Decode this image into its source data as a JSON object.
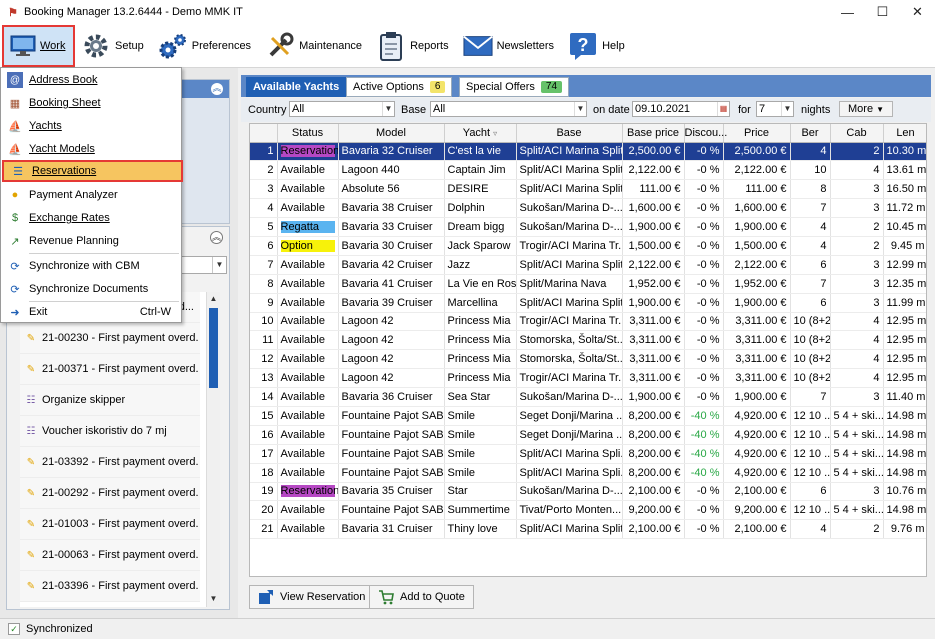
{
  "window": {
    "title": "Booking Manager 13.2.6444 - Demo MMK IT"
  },
  "toolbar": {
    "items": [
      {
        "label": "Work",
        "icon": "monitor-icon"
      },
      {
        "label": "Setup",
        "icon": "gear-icon"
      },
      {
        "label": "Preferences",
        "icon": "gears-icon"
      },
      {
        "label": "Maintenance",
        "icon": "wrench-icon"
      },
      {
        "label": "Reports",
        "icon": "clipboard-icon"
      },
      {
        "label": "Newsletters",
        "icon": "envelope-icon"
      },
      {
        "label": "Help",
        "icon": "help-icon"
      }
    ]
  },
  "menu": {
    "items": [
      {
        "label": "Address Book",
        "icon": "address-book-icon"
      },
      {
        "label": "Booking Sheet",
        "icon": "calendar-icon"
      },
      {
        "label": "Yachts",
        "icon": "sailboat-icon"
      },
      {
        "label": "Yacht Models",
        "icon": "sailboat-icon"
      },
      {
        "label": "Reservations",
        "icon": "reservations-icon"
      },
      {
        "label": "Payment Analyzer",
        "icon": "coins-icon"
      },
      {
        "label": "Exchange Rates",
        "icon": "currency-icon"
      },
      {
        "label": "Revenue Planning",
        "icon": "chart-icon"
      },
      {
        "label": "Synchronize with CBM",
        "icon": "sync-icon"
      },
      {
        "label": "Synchronize Documents",
        "icon": "sync-icon"
      },
      {
        "label": "Exit",
        "icon": "exit-icon",
        "shortcut": "Ctrl-W"
      }
    ]
  },
  "tasks": [
    {
      "text": "21-00230 - First payment overd...",
      "icon": "payment"
    },
    {
      "text": "21-00371 - First payment overd...",
      "icon": "payment"
    },
    {
      "text": "Organize skipper",
      "icon": "organize"
    },
    {
      "text": "Voucher iskoristiv do 7 mj",
      "icon": "organize"
    },
    {
      "text": "21-03392 - First payment overd...",
      "icon": "payment"
    },
    {
      "text": "21-00292 - First payment overd...",
      "icon": "payment"
    },
    {
      "text": "21-01003 - First payment overd...",
      "icon": "payment"
    },
    {
      "text": "21-00063 - First payment overd...",
      "icon": "payment"
    },
    {
      "text": "21-03396 - First payment overd...",
      "icon": "payment"
    }
  ],
  "task_partial": "d...",
  "tabs": {
    "available": "Available Yachts",
    "options": "Active Options",
    "options_count": "6",
    "offers": "Special Offers",
    "offers_count": "74"
  },
  "filters": {
    "country_label": "Country",
    "country_value": "All",
    "base_label": "Base",
    "base_value": "All",
    "date_label": "on date",
    "date_value": "09.10.2021",
    "for_label": "for",
    "nights_value": "7",
    "nights_label": "nights",
    "more_label": "More"
  },
  "grid": {
    "columns": [
      "",
      "Status",
      "Model",
      "Yacht",
      "Base",
      "Base price",
      "Discou...",
      "Price",
      "Ber",
      "Cab",
      "Len"
    ],
    "rows": [
      [
        "1",
        "Reservation",
        "Bavaria 32 Cruiser",
        "C'est la vie",
        "Split/ACI Marina Split",
        "2,500.00 €",
        "-0 %",
        "2,500.00 €",
        "4",
        "2",
        "10.30 m"
      ],
      [
        "2",
        "Available",
        "Lagoon 440",
        "Captain Jim",
        "Split/ACI Marina Split",
        "2,122.00 €",
        "-0 %",
        "2,122.00 €",
        "10",
        "4",
        "13.61 m"
      ],
      [
        "3",
        "Available",
        "Absolute 56",
        "DESIRE",
        "Split/ACI Marina Split",
        "111.00 €",
        "-0 %",
        "111.00 €",
        "8",
        "3",
        "16.50 m"
      ],
      [
        "4",
        "Available",
        "Bavaria 38 Cruiser",
        "Dolphin",
        "Sukošan/Marina D-...",
        "1,600.00 €",
        "-0 %",
        "1,600.00 €",
        "7",
        "3",
        "11.72 m"
      ],
      [
        "5",
        "Regatta",
        "Bavaria 33 Cruiser",
        "Dream bigg",
        "Sukošan/Marina D-...",
        "1,900.00 €",
        "-0 %",
        "1,900.00 €",
        "4",
        "2",
        "10.45 m"
      ],
      [
        "6",
        "Option",
        "Bavaria 30 Cruiser",
        "Jack Sparow",
        "Trogir/ACI Marina Tr...",
        "1,500.00 €",
        "-0 %",
        "1,500.00 €",
        "4",
        "2",
        "9.45 m"
      ],
      [
        "7",
        "Available",
        "Bavaria 42 Cruiser",
        "Jazz",
        "Split/ACI Marina Split",
        "2,122.00 €",
        "-0 %",
        "2,122.00 €",
        "6",
        "3",
        "12.99 m"
      ],
      [
        "8",
        "Available",
        "Bavaria 41 Cruiser",
        "La Vie en Rose",
        "Split/Marina Nava",
        "1,952.00 €",
        "-0 %",
        "1,952.00 €",
        "7",
        "3",
        "12.35 m"
      ],
      [
        "9",
        "Available",
        "Bavaria 39 Cruiser",
        "Marcellina",
        "Split/ACI Marina Split",
        "1,900.00 €",
        "-0 %",
        "1,900.00 €",
        "6",
        "3",
        "11.99 m"
      ],
      [
        "10",
        "Available",
        "Lagoon 42",
        "Princess Mia",
        "Trogir/ACI Marina Tr...",
        "3,311.00 €",
        "-0 %",
        "3,311.00 €",
        "10 (8+2)",
        "4",
        "12.95 m"
      ],
      [
        "11",
        "Available",
        "Lagoon 42",
        "Princess Mia",
        "Stomorska, Šolta/St...",
        "3,311.00 €",
        "-0 %",
        "3,311.00 €",
        "10 (8+2)",
        "4",
        "12.95 m"
      ],
      [
        "12",
        "Available",
        "Lagoon 42",
        "Princess Mia",
        "Stomorska, Šolta/St...",
        "3,311.00 €",
        "-0 %",
        "3,311.00 €",
        "10 (8+2)",
        "4",
        "12.95 m"
      ],
      [
        "13",
        "Available",
        "Lagoon 42",
        "Princess Mia",
        "Trogir/ACI Marina Tr...",
        "3,311.00 €",
        "-0 %",
        "3,311.00 €",
        "10 (8+2)",
        "4",
        "12.95 m"
      ],
      [
        "14",
        "Available",
        "Bavaria 36 Cruiser",
        "Sea Star",
        "Sukošan/Marina D-...",
        "1,900.00 €",
        "-0 %",
        "1,900.00 €",
        "7",
        "3",
        "11.40 m"
      ],
      [
        "15",
        "Available",
        "Fountaine Pajot SAB...",
        "Smile",
        "Seget Donji/Marina ...",
        "8,200.00 €",
        "-40 %",
        "4,920.00 €",
        "12 10 ...",
        "5 4 + ski...",
        "14.98 m"
      ],
      [
        "16",
        "Available",
        "Fountaine Pajot SAB...",
        "Smile",
        "Seget Donji/Marina ...",
        "8,200.00 €",
        "-40 %",
        "4,920.00 €",
        "12 10 ...",
        "5 4 + ski...",
        "14.98 m"
      ],
      [
        "17",
        "Available",
        "Fountaine Pajot SAB...",
        "Smile",
        "Split/ACI Marina Spli...",
        "8,200.00 €",
        "-40 %",
        "4,920.00 €",
        "12 10 ...",
        "5 4 + ski...",
        "14.98 m"
      ],
      [
        "18",
        "Available",
        "Fountaine Pajot SAB...",
        "Smile",
        "Split/ACI Marina Spli...",
        "8,200.00 €",
        "-40 %",
        "4,920.00 €",
        "12 10 ...",
        "5 4 + ski...",
        "14.98 m"
      ],
      [
        "19",
        "Reservation",
        "Bavaria 35 Cruiser",
        "Star",
        "Sukošan/Marina D-...",
        "2,100.00 €",
        "-0 %",
        "2,100.00 €",
        "6",
        "3",
        "10.76 m"
      ],
      [
        "20",
        "Available",
        "Fountaine Pajot SAB...",
        "Summertime",
        "Tivat/Porto Monten...",
        "9,200.00 €",
        "-0 %",
        "9,200.00 €",
        "12 10 ...",
        "5 4 + ski...",
        "14.98 m"
      ],
      [
        "21",
        "Available",
        "Bavaria 31 Cruiser",
        "Thiny love",
        "Split/ACI Marina Split",
        "2,100.00 €",
        "-0 %",
        "2,100.00 €",
        "4",
        "2",
        "9.76 m"
      ]
    ]
  },
  "buttons": {
    "view_reservation": "View Reservation",
    "add_to_quote": "Add to Quote"
  },
  "status": {
    "text": "Synchronized"
  },
  "colors": {
    "accent": "#1f5fb4",
    "highlight_border": "#e53935",
    "reservation": "#b648c4",
    "regatta": "#5ab4f0",
    "option": "#f7f20a",
    "discount_green": "#28a745"
  }
}
